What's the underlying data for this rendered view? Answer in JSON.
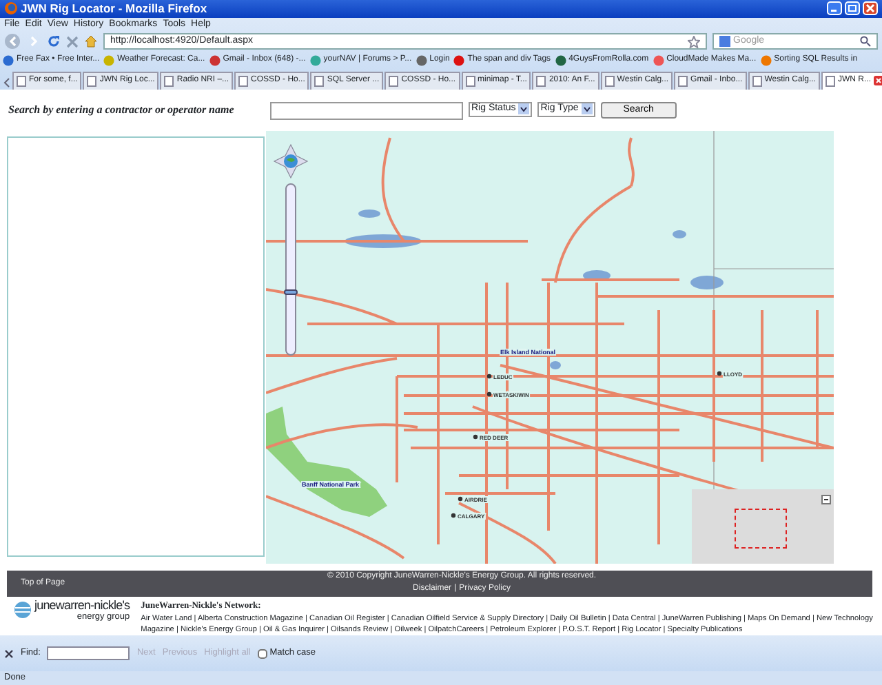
{
  "window": {
    "title": "JWN Rig Locator - Mozilla Firefox"
  },
  "menu": [
    "File",
    "Edit",
    "View",
    "History",
    "Bookmarks",
    "Tools",
    "Help"
  ],
  "address_bar": {
    "value": "http://localhost:4920/Default.aspx"
  },
  "web_search": {
    "placeholder": "Google"
  },
  "bookmarks": [
    "Free Fax • Free Inter...",
    "Weather Forecast: Ca...",
    "Gmail - Inbox (648) -...",
    "yourNAV | Forums > P...",
    "Login",
    "The span and div Tags",
    "4GuysFromRolla.com",
    "CloudMade Makes Ma...",
    "Sorting SQL Results in"
  ],
  "tabs": [
    {
      "label": "For some, f...",
      "selected": false
    },
    {
      "label": "JWN Rig Loc...",
      "selected": false
    },
    {
      "label": "Radio NRI –...",
      "selected": false
    },
    {
      "label": "COSSD - Ho...",
      "selected": false
    },
    {
      "label": "SQL Server ...",
      "selected": false
    },
    {
      "label": "COSSD - Ho...",
      "selected": false
    },
    {
      "label": "minimap - T...",
      "selected": false
    },
    {
      "label": "2010: An F...",
      "selected": false
    },
    {
      "label": "Westin Calg...",
      "selected": false
    },
    {
      "label": "Gmail - Inbo...",
      "selected": false
    },
    {
      "label": "Westin Calg...",
      "selected": false
    },
    {
      "label": "JWN R...",
      "selected": true
    }
  ],
  "search": {
    "label": "Search by entering a contractor or operator name",
    "rig_status": "Rig Status",
    "rig_type": "Rig Type",
    "button": "Search"
  },
  "map": {
    "zoom_slider": {
      "level": 0.34
    },
    "labels": [
      {
        "text": "Elk Island National",
        "kind": "park"
      },
      {
        "text": "LEDUC",
        "kind": "town"
      },
      {
        "text": "WETASKIWIN",
        "kind": "town"
      },
      {
        "text": "RED DEER",
        "kind": "town"
      },
      {
        "text": "AIRDRIE",
        "kind": "town"
      },
      {
        "text": "CALGARY",
        "kind": "town"
      },
      {
        "text": "LLOYD",
        "kind": "town"
      },
      {
        "text": "Banff National Park",
        "kind": "park"
      }
    ]
  },
  "footer": {
    "top_link": "Top of Page",
    "copyright": "© 2010  Copyright JuneWarren-Nickle's Energy Group. All rights reserved.",
    "links": [
      "Disclaimer",
      "Privacy Policy"
    ],
    "separator": "|"
  },
  "network": {
    "logo_name": "junewarren-nickle's",
    "logo_sub": "energy group",
    "heading": "JuneWarren-Nickle's Network:",
    "links": "Air Water Land | Alberta Construction Magazine | Canadian Oil Register | Canadian Oilfield Service & Supply Directory | Daily Oil Bulletin | Data Central | JuneWarren Publishing | Maps On Demand | New Technology Magazine | Nickle's Energy Group | Oil & Gas Inquirer | Oilsands Review | Oilweek | OilpatchCareers | Petroleum Explorer | P.O.S.T. Report | Rig Locator | Specialty Publications"
  },
  "find_bar": {
    "label": "Find:",
    "buttons": [
      {
        "label": "Next",
        "disabled": true
      },
      {
        "label": "Previous",
        "disabled": true
      },
      {
        "label": "Highlight all",
        "disabled": true
      }
    ],
    "match_case": {
      "label": "Match case",
      "checked": false
    }
  },
  "status_bar": "Done"
}
